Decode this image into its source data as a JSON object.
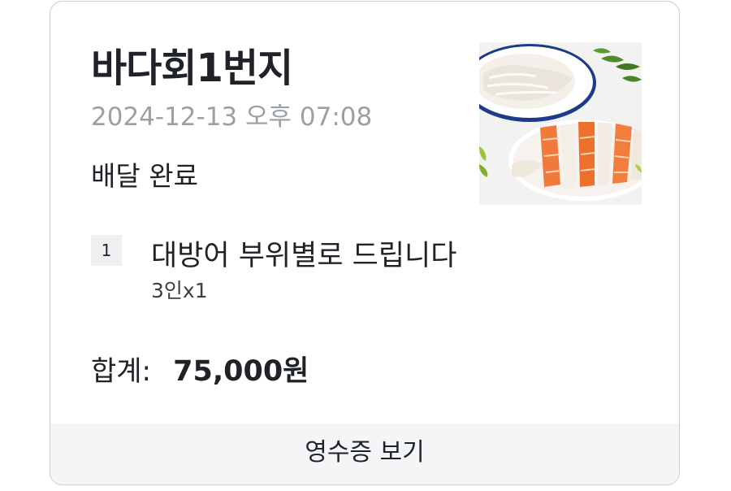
{
  "order_card": {
    "store_name": "바다회1번지",
    "order_date": "2024-12-13 오후 07:08",
    "status": "배달 완료",
    "item": {
      "quantity": "1",
      "name": "대방어 부위별로 드립니다",
      "option": "3인x1"
    },
    "total": {
      "label": "합계:",
      "amount": "75,000원"
    },
    "receipt_button_label": "영수증 보기"
  },
  "colors": {
    "text_primary": "#1f2328",
    "text_muted": "#9aa0a6",
    "card_border": "#c9ccd1",
    "button_bg": "#f4f5f7",
    "badge_bg": "#eeeff1"
  }
}
